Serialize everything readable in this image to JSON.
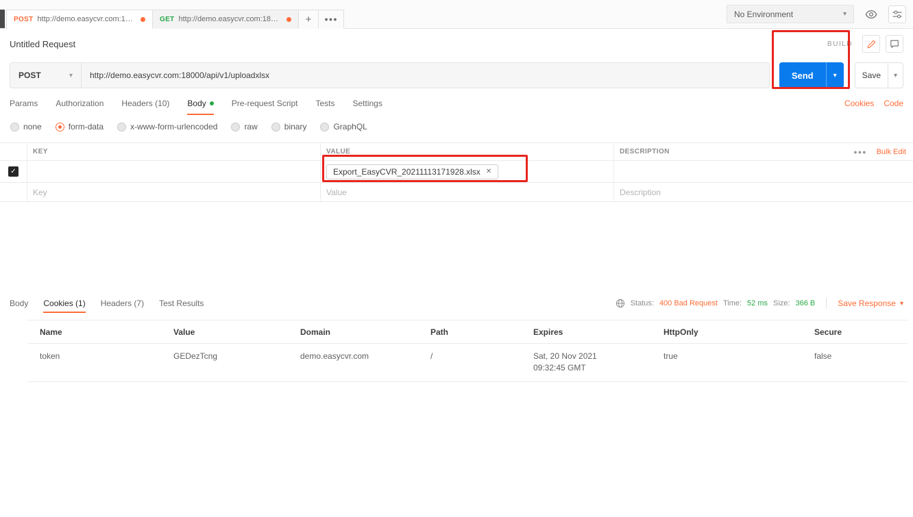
{
  "colors": {
    "accent_orange": "#ff6c37",
    "send_blue": "#097bed",
    "success_green": "#29a847",
    "annotation_red": "#e8251d"
  },
  "icons": {
    "caret_down": "▾",
    "check": "✓",
    "close": "✕",
    "plus": "+",
    "ellipsis": "●●●"
  },
  "topbar": {
    "tabs": [
      {
        "method": "POST",
        "url": "http://demo.easycvr.com:180..."
      },
      {
        "method": "GET",
        "url": "http://demo.easycvr.com:1800..."
      }
    ],
    "environment": "No Environment"
  },
  "request_header": {
    "title": "Untitled Request",
    "build": "BUILD"
  },
  "url_bar": {
    "method": "POST",
    "url": "http://demo.easycvr.com:18000/api/v1/uploadxlsx",
    "send": "Send",
    "save": "Save"
  },
  "request_tabs": {
    "items": [
      {
        "label": "Params"
      },
      {
        "label": "Authorization"
      },
      {
        "label": "Headers (10)"
      },
      {
        "label": "Body"
      },
      {
        "label": "Pre-request Script"
      },
      {
        "label": "Tests"
      },
      {
        "label": "Settings"
      }
    ],
    "active": "Body",
    "cookies_link": "Cookies",
    "code_link": "Code"
  },
  "body_modes": {
    "selected": "form-data",
    "options": [
      {
        "label": "none"
      },
      {
        "label": "form-data"
      },
      {
        "label": "x-www-form-urlencoded"
      },
      {
        "label": "raw"
      },
      {
        "label": "binary"
      },
      {
        "label": "GraphQL"
      }
    ]
  },
  "form_table": {
    "headers": {
      "key": "KEY",
      "value": "VALUE",
      "description": "DESCRIPTION"
    },
    "more": "●●●",
    "bulk_edit": "Bulk Edit",
    "row": {
      "checked": true,
      "file_chip": "Export_EasyCVR_20211113171928.xlsx",
      "chip_close": "✕"
    },
    "placeholders": {
      "key": "Key",
      "value": "Value",
      "description": "Description"
    }
  },
  "response": {
    "tabs": [
      {
        "label": "Body"
      },
      {
        "label": "Cookies (1)"
      },
      {
        "label": "Headers (7)"
      },
      {
        "label": "Test Results"
      }
    ],
    "active": "Cookies (1)",
    "status_label": "Status:",
    "status": "400 Bad Request",
    "time_label": "Time:",
    "time": "52 ms",
    "size_label": "Size:",
    "size": "366 B",
    "save_response": "Save Response"
  },
  "cookies_table": {
    "headers": [
      "Name",
      "Value",
      "Domain",
      "Path",
      "Expires",
      "HttpOnly",
      "Secure"
    ],
    "rows": [
      {
        "name": "token",
        "value": "GEDezTcng",
        "domain": "demo.easycvr.com",
        "path": "/",
        "expires": "Sat, 20 Nov 2021 09:32:45 GMT",
        "httponly": "true",
        "secure": "false"
      }
    ]
  }
}
